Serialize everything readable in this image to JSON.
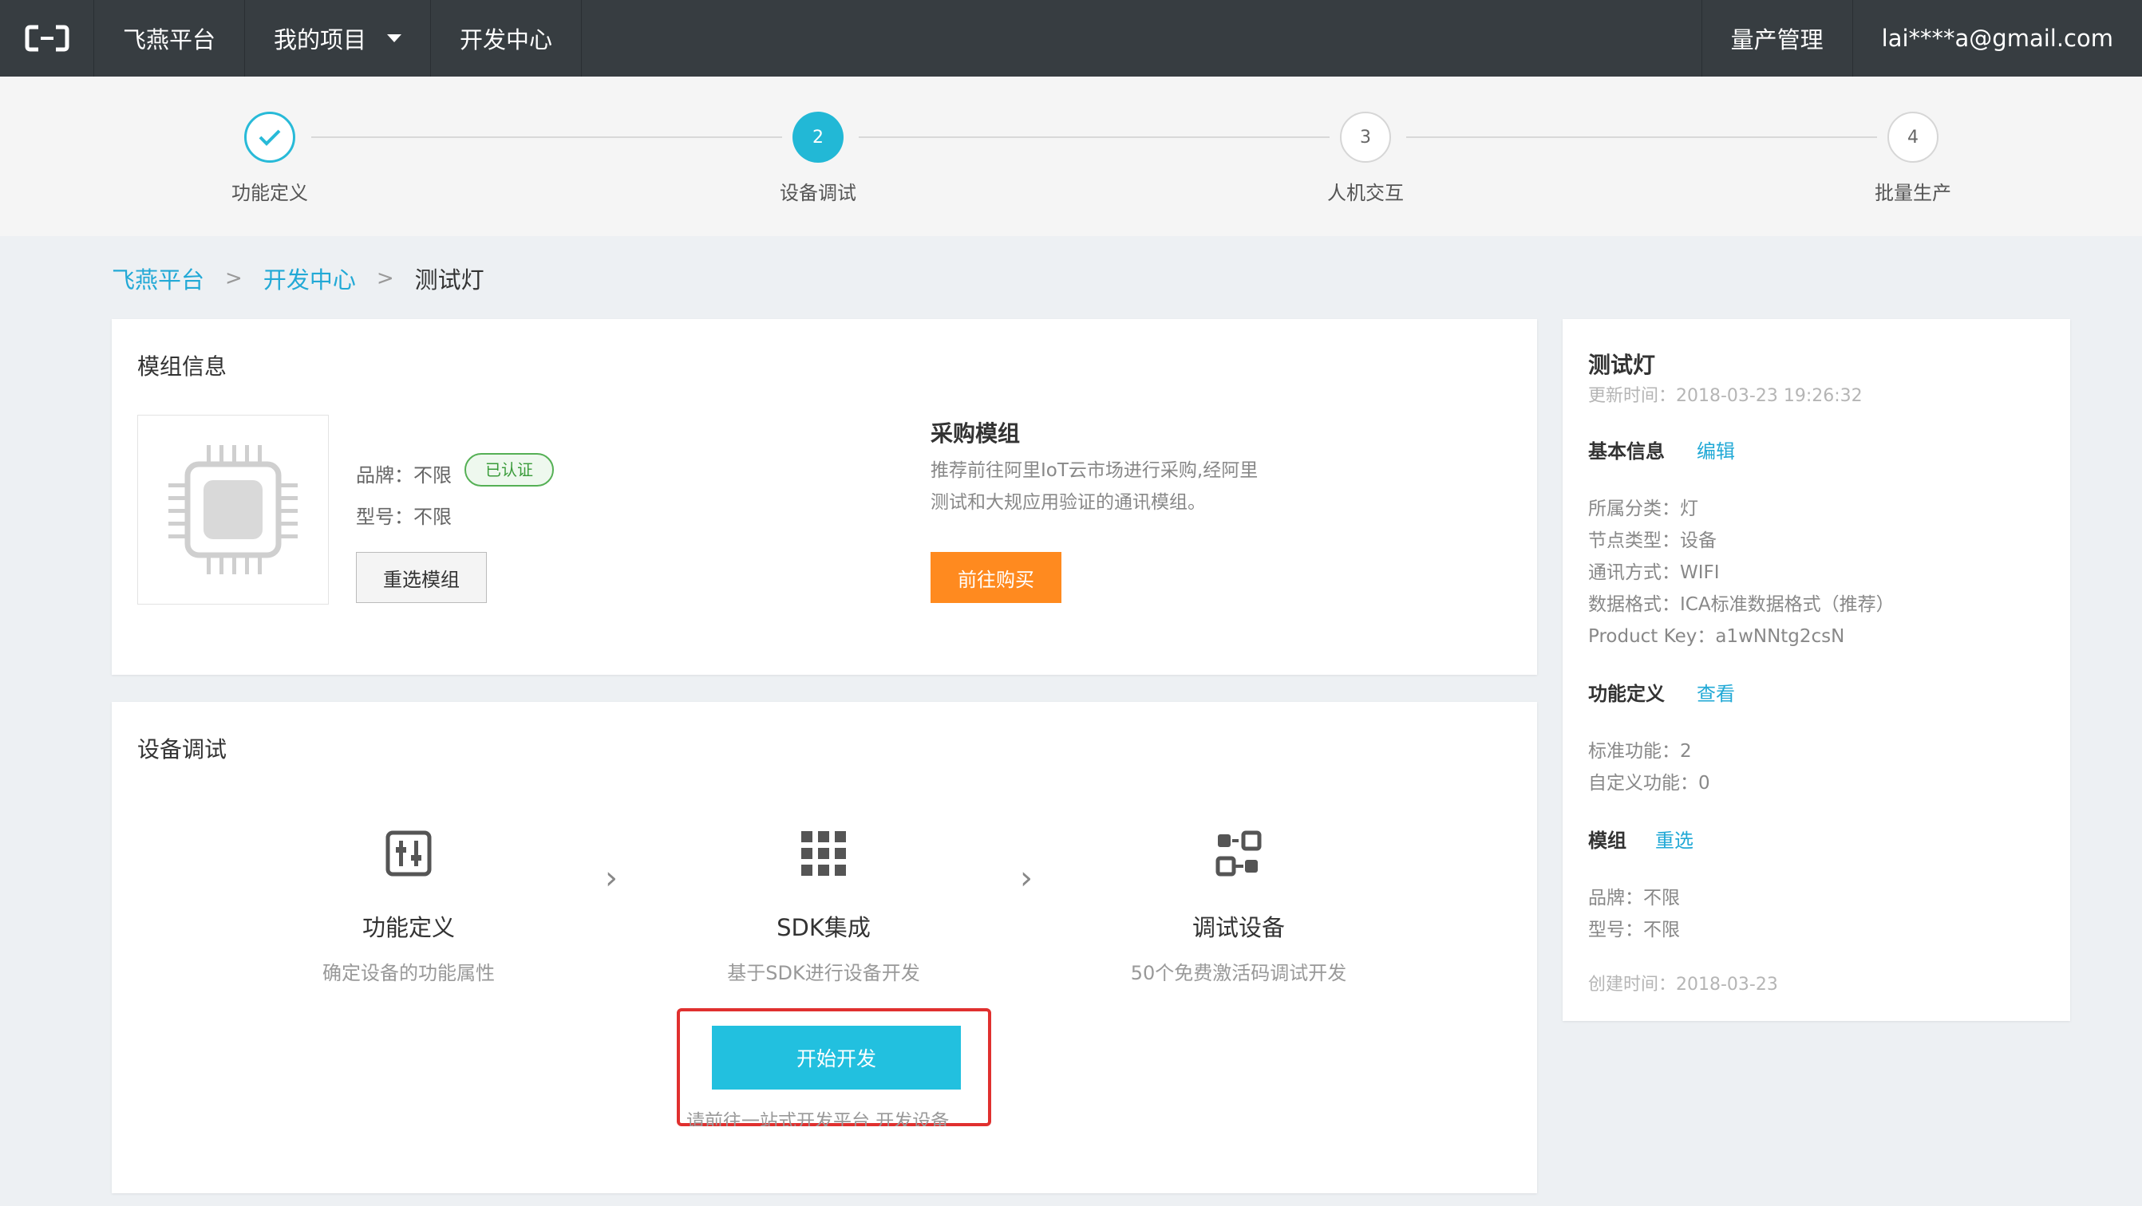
{
  "nav": {
    "platform": "飞燕平台",
    "my_projects": "我的项目",
    "dev_center": "开发中心",
    "mass_production": "量产管理",
    "user_email": "lai****a@gmail.com"
  },
  "steps": [
    {
      "num": "",
      "label": "功能定义",
      "state": "done"
    },
    {
      "num": "2",
      "label": "设备调试",
      "state": "active"
    },
    {
      "num": "3",
      "label": "人机交互",
      "state": "pending"
    },
    {
      "num": "4",
      "label": "批量生产",
      "state": "pending"
    }
  ],
  "breadcrumb": {
    "item1": "飞燕平台",
    "item2": "开发中心",
    "current": "测试灯"
  },
  "module_card": {
    "title": "模组信息",
    "brand": "品牌：不限",
    "certified": "已认证",
    "model": "型号：不限",
    "reselect_button": "重选模组",
    "purchase_title": "采购模组",
    "purchase_desc_line1": "推荐前往阿里IoT云市场进行采购,经阿里",
    "purchase_desc_line2": "测试和大规应用验证的通讯模组。",
    "buy_button": "前往购买"
  },
  "debug_card": {
    "title": "设备调试",
    "flow": [
      {
        "icon": "sliders-icon",
        "title": "功能定义",
        "desc": "确定设备的功能属性"
      },
      {
        "icon": "grid-icon",
        "title": "SDK集成",
        "desc": "基于SDK进行设备开发"
      },
      {
        "icon": "debug-device-icon",
        "title": "调试设备",
        "desc": "50个免费激活码调试开发"
      }
    ],
    "start_button": "开始开发",
    "hint": "请前往一站式开发平台 开发设备"
  },
  "side_panel": {
    "title": "测试灯",
    "updated": "更新时间：2018-03-23 19:26:32",
    "basic_info": "基本信息",
    "edit": "编辑",
    "category": "所属分类：灯",
    "node_type": "节点类型：设备",
    "comm": "通讯方式：WIFI",
    "data_format": "数据格式：ICA标准数据格式（推荐）",
    "product_key": "Product Key：a1wNNtg2csN",
    "func_def": "功能定义",
    "view": "查看",
    "std_func": "标准功能：2",
    "custom_func": "自定义功能：0",
    "module": "模组",
    "reselect": "重选",
    "brand": "品牌：不限",
    "model": "型号：不限",
    "created": "创建时间：2018-03-23"
  },
  "colors": {
    "nav_bg": "#373d41",
    "accent": "#22b8d6",
    "orange": "#ff8a1f",
    "highlight": "#e0302f"
  }
}
